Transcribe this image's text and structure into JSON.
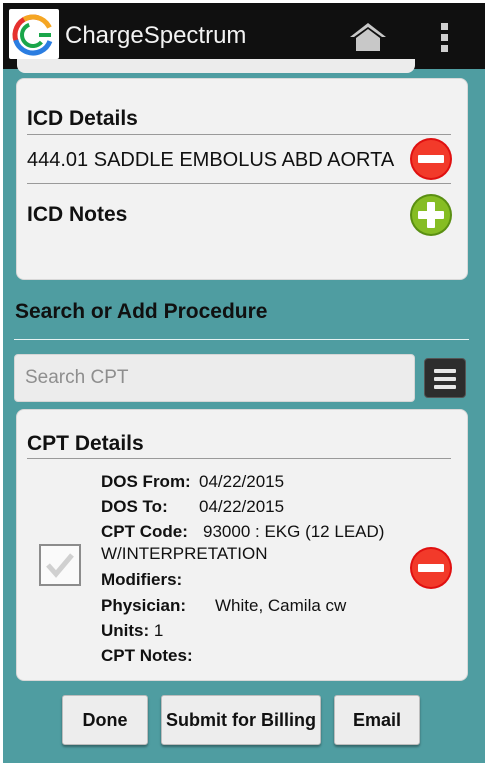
{
  "app": {
    "title": "ChargeSpectrum"
  },
  "icd": {
    "heading": "ICD Details",
    "code_line": "444.01 SADDLE EMBOLUS ABD AORTA",
    "notes_label": "ICD Notes"
  },
  "procedure": {
    "heading": "Search or Add Procedure",
    "search_placeholder": "Search CPT"
  },
  "cpt": {
    "heading": "CPT Details",
    "dos_from_label": "DOS From:",
    "dos_from_value": "04/22/2015",
    "dos_to_label": "DOS To:",
    "dos_to_value": "04/22/2015",
    "cpt_code_label": "CPT Code:",
    "cpt_code_value": "93000 : EKG (12 LEAD)",
    "cpt_code_value_cont": "W/INTERPRETATION",
    "modifiers_label": "Modifiers:",
    "physician_label": "Physician:",
    "physician_value": "White, Camila cw",
    "units_label": "Units:",
    "units_value": "1",
    "notes_label": "CPT Notes:"
  },
  "footer": {
    "done_label": "Done",
    "submit_label": "Submit for Billing",
    "email_label": "Email"
  },
  "icons": {
    "logo": "chargespectrum-logo",
    "home": "home-icon",
    "overflow": "overflow-menu-icon",
    "remove": "remove-icon",
    "add": "add-icon",
    "list": "list-icon",
    "check": "check-icon"
  },
  "colors": {
    "background": "#4f9da1",
    "appbar": "#101010",
    "remove": "#e01010",
    "add": "#7ab51d"
  }
}
